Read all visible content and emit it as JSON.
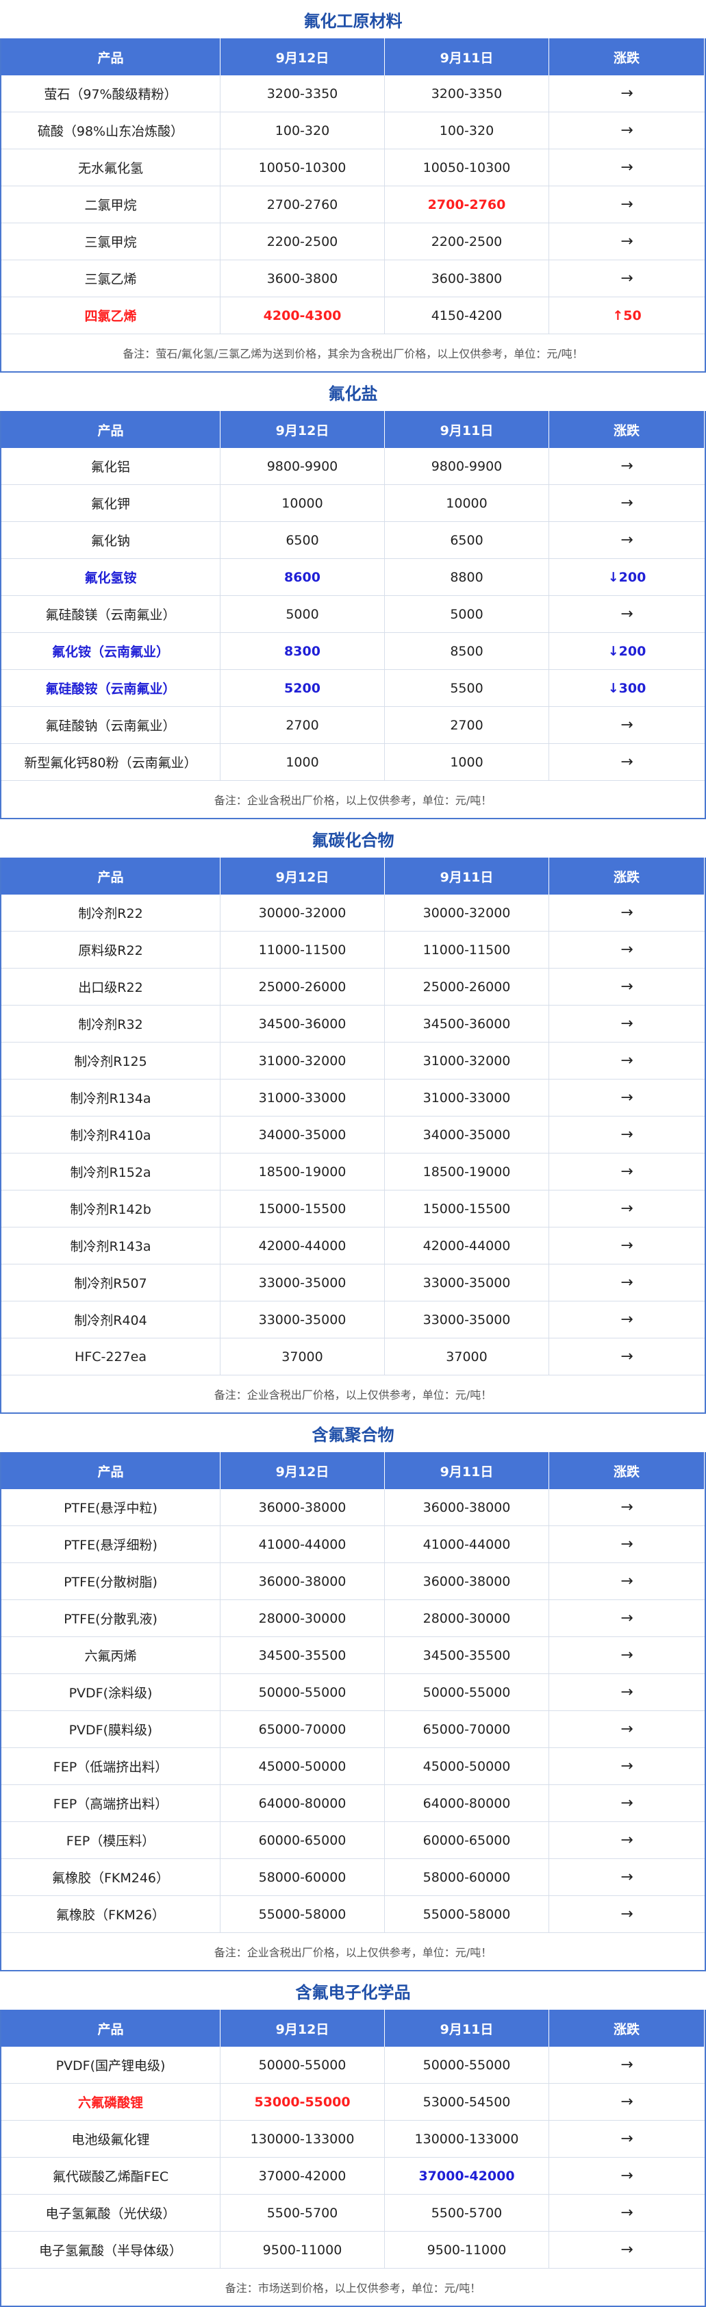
{
  "header": {
    "col_product": "产品",
    "col_d1": "9月12日",
    "col_d2": "9月11日",
    "col_change": "涨跌"
  },
  "flat_arrow": "→",
  "sections": [
    {
      "title": "氟化工原材料",
      "rows": [
        {
          "p": "萤石（97%酸级精粉）",
          "d1": "3200-3350",
          "d2": "3200-3350",
          "ch": "→",
          "hl": ""
        },
        {
          "p": "硫酸（98%山东冶炼酸）",
          "d1": "100-320",
          "d2": "100-320",
          "ch": "→",
          "hl": ""
        },
        {
          "p": "无水氟化氢",
          "d1": "10050-10300",
          "d2": "10050-10300",
          "ch": "→",
          "hl": ""
        },
        {
          "p": "二氯甲烷",
          "d1": "2700-2760",
          "d2": "2700-2760",
          "ch": "→",
          "hl": "d2red"
        },
        {
          "p": "三氯甲烷",
          "d1": "2200-2500",
          "d2": "2200-2500",
          "ch": "→",
          "hl": ""
        },
        {
          "p": "三氯乙烯",
          "d1": "3600-3800",
          "d2": "3600-3800",
          "ch": "→",
          "hl": ""
        },
        {
          "p": "四氯乙烯",
          "d1": "4200-4300",
          "d2": "4150-4200",
          "ch": "↑50",
          "hl": "red"
        }
      ],
      "note": "备注：萤石/氟化氢/三氯乙烯为送到价格，其余为含税出厂价格，以上仅供参考，单位：元/吨！"
    },
    {
      "title": "氟化盐",
      "rows": [
        {
          "p": "氟化铝",
          "d1": "9800-9900",
          "d2": "9800-9900",
          "ch": "→",
          "hl": ""
        },
        {
          "p": "氟化钾",
          "d1": "10000",
          "d2": "10000",
          "ch": "→",
          "hl": ""
        },
        {
          "p": "氟化钠",
          "d1": "6500",
          "d2": "6500",
          "ch": "→",
          "hl": ""
        },
        {
          "p": "氟化氢铵",
          "d1": "8600",
          "d2": "8800",
          "ch": "↓200",
          "hl": "blue"
        },
        {
          "p": "氟硅酸镁（云南氟业）",
          "d1": "5000",
          "d2": "5000",
          "ch": "→",
          "hl": ""
        },
        {
          "p": "氟化铵（云南氟业）",
          "d1": "8300",
          "d2": "8500",
          "ch": "↓200",
          "hl": "blue"
        },
        {
          "p": "氟硅酸铵（云南氟业）",
          "d1": "5200",
          "d2": "5500",
          "ch": "↓300",
          "hl": "blue"
        },
        {
          "p": "氟硅酸钠（云南氟业）",
          "d1": "2700",
          "d2": "2700",
          "ch": "→",
          "hl": ""
        },
        {
          "p": "新型氟化钙80粉（云南氟业）",
          "d1": "1000",
          "d2": "1000",
          "ch": "→",
          "hl": ""
        }
      ],
      "note": "备注：企业含税出厂价格，以上仅供参考，单位：元/吨！"
    },
    {
      "title": "氟碳化合物",
      "rows": [
        {
          "p": "制冷剂R22",
          "d1": "30000-32000",
          "d2": "30000-32000",
          "ch": "→",
          "hl": ""
        },
        {
          "p": "原料级R22",
          "d1": "11000-11500",
          "d2": "11000-11500",
          "ch": "→",
          "hl": ""
        },
        {
          "p": "出口级R22",
          "d1": "25000-26000",
          "d2": "25000-26000",
          "ch": "→",
          "hl": ""
        },
        {
          "p": "制冷剂R32",
          "d1": "34500-36000",
          "d2": "34500-36000",
          "ch": "→",
          "hl": ""
        },
        {
          "p": "制冷剂R125",
          "d1": "31000-32000",
          "d2": "31000-32000",
          "ch": "→",
          "hl": ""
        },
        {
          "p": "制冷剂R134a",
          "d1": "31000-33000",
          "d2": "31000-33000",
          "ch": "→",
          "hl": ""
        },
        {
          "p": "制冷剂R410a",
          "d1": "34000-35000",
          "d2": "34000-35000",
          "ch": "→",
          "hl": ""
        },
        {
          "p": "制冷剂R152a",
          "d1": "18500-19000",
          "d2": "18500-19000",
          "ch": "→",
          "hl": ""
        },
        {
          "p": "制冷剂R142b",
          "d1": "15000-15500",
          "d2": "15000-15500",
          "ch": "→",
          "hl": ""
        },
        {
          "p": "制冷剂R143a",
          "d1": "42000-44000",
          "d2": "42000-44000",
          "ch": "→",
          "hl": ""
        },
        {
          "p": "制冷剂R507",
          "d1": "33000-35000",
          "d2": "33000-35000",
          "ch": "→",
          "hl": ""
        },
        {
          "p": "制冷剂R404",
          "d1": "33000-35000",
          "d2": "33000-35000",
          "ch": "→",
          "hl": ""
        },
        {
          "p": "HFC-227ea",
          "d1": "37000",
          "d2": "37000",
          "ch": "→",
          "hl": ""
        }
      ],
      "note": "备注：企业含税出厂价格，以上仅供参考，单位：元/吨！"
    },
    {
      "title": "含氟聚合物",
      "rows": [
        {
          "p": "PTFE(悬浮中粒)",
          "d1": "36000-38000",
          "d2": "36000-38000",
          "ch": "→",
          "hl": ""
        },
        {
          "p": "PTFE(悬浮细粉)",
          "d1": "41000-44000",
          "d2": "41000-44000",
          "ch": "→",
          "hl": ""
        },
        {
          "p": "PTFE(分散树脂)",
          "d1": "36000-38000",
          "d2": "36000-38000",
          "ch": "→",
          "hl": ""
        },
        {
          "p": "PTFE(分散乳液)",
          "d1": "28000-30000",
          "d2": "28000-30000",
          "ch": "→",
          "hl": ""
        },
        {
          "p": "六氟丙烯",
          "d1": "34500-35500",
          "d2": "34500-35500",
          "ch": "→",
          "hl": ""
        },
        {
          "p": "PVDF(涂料级)",
          "d1": "50000-55000",
          "d2": "50000-55000",
          "ch": "→",
          "hl": ""
        },
        {
          "p": "PVDF(膜料级)",
          "d1": "65000-70000",
          "d2": "65000-70000",
          "ch": "→",
          "hl": ""
        },
        {
          "p": "FEP（低端挤出料）",
          "d1": "45000-50000",
          "d2": "45000-50000",
          "ch": "→",
          "hl": ""
        },
        {
          "p": "FEP（高端挤出料）",
          "d1": "64000-80000",
          "d2": "64000-80000",
          "ch": "→",
          "hl": ""
        },
        {
          "p": "FEP（模压料）",
          "d1": "60000-65000",
          "d2": "60000-65000",
          "ch": "→",
          "hl": ""
        },
        {
          "p": "氟橡胶（FKM246）",
          "d1": "58000-60000",
          "d2": "58000-60000",
          "ch": "→",
          "hl": ""
        },
        {
          "p": "氟橡胶（FKM26）",
          "d1": "55000-58000",
          "d2": "55000-58000",
          "ch": "→",
          "hl": ""
        }
      ],
      "note": "备注：企业含税出厂价格，以上仅供参考，单位：元/吨！"
    },
    {
      "title": "含氟电子化学品",
      "rows": [
        {
          "p": "PVDF(国产锂电级)",
          "d1": "50000-55000",
          "d2": "50000-55000",
          "ch": "→",
          "hl": ""
        },
        {
          "p": "六氟磷酸锂",
          "d1": "53000-55000",
          "d2": "53000-54500",
          "ch": "→",
          "hl": "red"
        },
        {
          "p": "电池级氟化锂",
          "d1": "130000-133000",
          "d2": "130000-133000",
          "ch": "→",
          "hl": ""
        },
        {
          "p": "氟代碳酸乙烯酯FEC",
          "d1": "37000-42000",
          "d2": "37000-42000",
          "ch": "→",
          "hl": "d2blue"
        },
        {
          "p": "电子氢氟酸（光伏级）",
          "d1": "5500-5700",
          "d2": "5500-5700",
          "ch": "→",
          "hl": ""
        },
        {
          "p": "电子氢氟酸（半导体级）",
          "d1": "9500-11000",
          "d2": "9500-11000",
          "ch": "→",
          "hl": ""
        }
      ],
      "note": "备注：市场送到价格，以上仅供参考，单位：元/吨！"
    }
  ]
}
